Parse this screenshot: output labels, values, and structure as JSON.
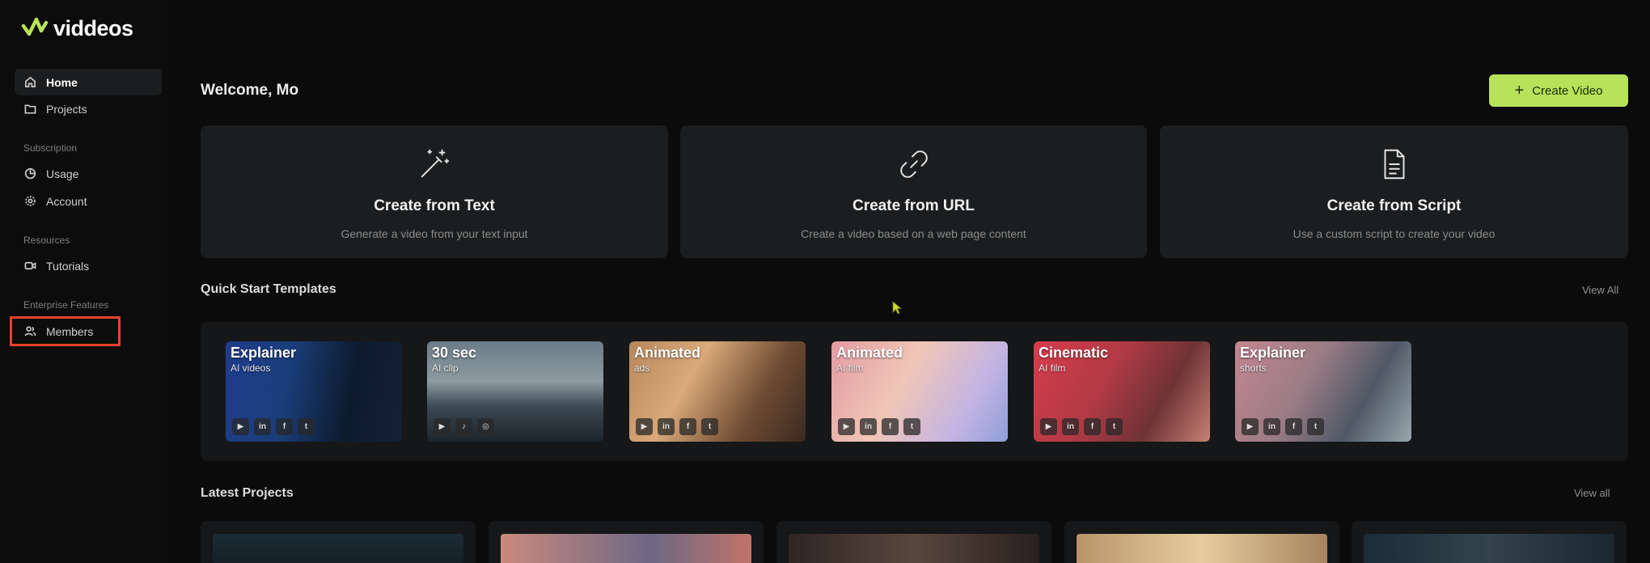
{
  "brand": {
    "name": "viddeos",
    "accent": "#b7e25a"
  },
  "sidebar": {
    "items": [
      {
        "label": "Home",
        "icon": "home-icon",
        "active": true
      },
      {
        "label": "Projects",
        "icon": "folder-icon"
      }
    ],
    "sections": [
      {
        "title": "Subscription",
        "items": [
          {
            "label": "Usage",
            "icon": "pie-chart-icon"
          },
          {
            "label": "Account",
            "icon": "settings-icon"
          }
        ]
      },
      {
        "title": "Resources",
        "items": [
          {
            "label": "Tutorials",
            "icon": "video-icon"
          }
        ]
      },
      {
        "title": "Enterprise Features",
        "items": [
          {
            "label": "Members",
            "icon": "users-icon"
          }
        ]
      }
    ]
  },
  "header": {
    "welcome": "Welcome, Mo",
    "create_button": "Create Video"
  },
  "create_options": [
    {
      "title": "Create from Text",
      "description": "Generate a video from your text input",
      "icon": "magic-wand-icon"
    },
    {
      "title": "Create from URL",
      "description": "Create a video based on a web page content",
      "icon": "link-icon"
    },
    {
      "title": "Create from Script",
      "description": "Use a custom script to create your video",
      "icon": "document-icon"
    }
  ],
  "templates": {
    "title": "Quick Start Templates",
    "view_all": "View All",
    "items": [
      {
        "title": "Explainer",
        "subtitle": "AI videos",
        "icons": [
          "youtube-icon",
          "linkedin-icon",
          "facebook-icon",
          "twitter-icon"
        ]
      },
      {
        "title": "30 sec",
        "subtitle": "AI clip",
        "icons": [
          "youtube-icon",
          "tiktok-icon",
          "instagram-icon"
        ]
      },
      {
        "title": "Animated",
        "subtitle": "ads",
        "icons": [
          "youtube-icon",
          "linkedin-icon",
          "facebook-icon",
          "twitter-icon"
        ]
      },
      {
        "title": "Animated",
        "subtitle": "AI film",
        "icons": [
          "youtube-icon",
          "linkedin-icon",
          "facebook-icon",
          "twitter-icon"
        ]
      },
      {
        "title": "Cinematic",
        "subtitle": "AI film",
        "icons": [
          "youtube-icon",
          "linkedin-icon",
          "facebook-icon",
          "twitter-icon"
        ]
      },
      {
        "title": "Explainer",
        "subtitle": "shorts",
        "icons": [
          "youtube-icon",
          "linkedin-icon",
          "facebook-icon",
          "twitter-icon"
        ]
      }
    ]
  },
  "projects": {
    "title": "Latest Projects",
    "view_all": "View all"
  }
}
